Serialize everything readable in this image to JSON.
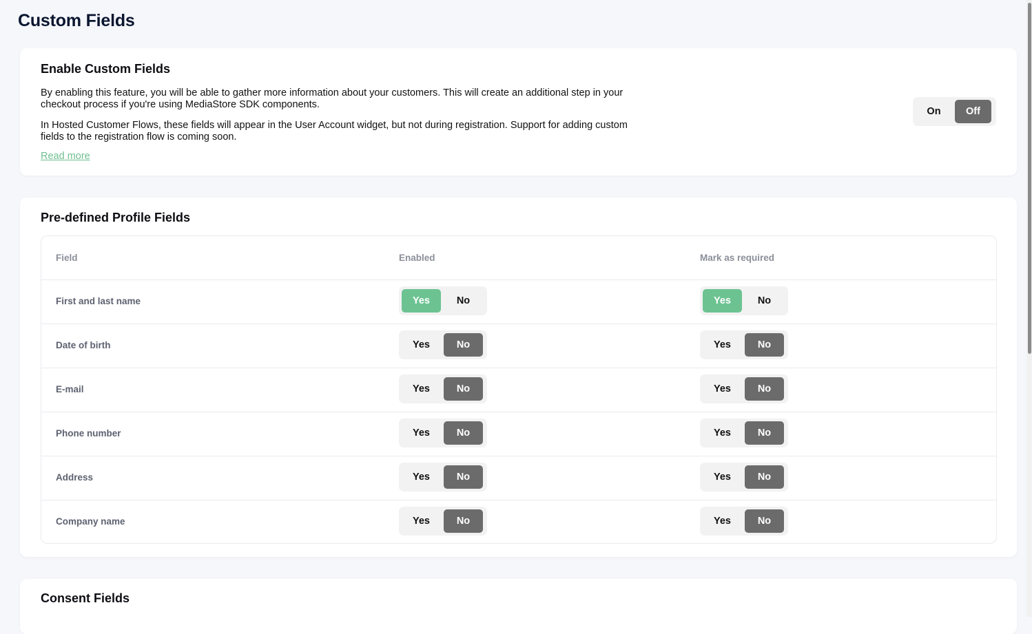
{
  "page": {
    "title": "Custom Fields"
  },
  "enable_section": {
    "title": "Enable Custom Fields",
    "paragraph1": "By enabling this feature, you will be able to gather more information about your customers. This will create an additional step in your checkout process if you're using MediaStore SDK components.",
    "paragraph2": "In Hosted Customer Flows, these fields will appear in the User Account widget, but not during registration. Support for adding custom fields to the registration flow is coming soon.",
    "read_more": "Read more",
    "toggle": {
      "on_label": "On",
      "off_label": "Off",
      "selected": "Off"
    }
  },
  "predefined_section": {
    "title": "Pre-defined Profile Fields",
    "columns": {
      "field": "Field",
      "enabled": "Enabled",
      "required": "Mark as required"
    },
    "yes_label": "Yes",
    "no_label": "No",
    "rows": [
      {
        "label": "First and last name",
        "enabled": "Yes",
        "required": "Yes"
      },
      {
        "label": "Date of birth",
        "enabled": "No",
        "required": "No"
      },
      {
        "label": "E-mail",
        "enabled": "No",
        "required": "No"
      },
      {
        "label": "Phone number",
        "enabled": "No",
        "required": "No"
      },
      {
        "label": "Address",
        "enabled": "No",
        "required": "No"
      },
      {
        "label": "Company name",
        "enabled": "No",
        "required": "No"
      }
    ]
  },
  "consent_section": {
    "title": "Consent Fields"
  },
  "colors": {
    "selected_yes": "#6cc391",
    "selected_no": "#6b6b6b",
    "link": "#6fbf8f"
  }
}
